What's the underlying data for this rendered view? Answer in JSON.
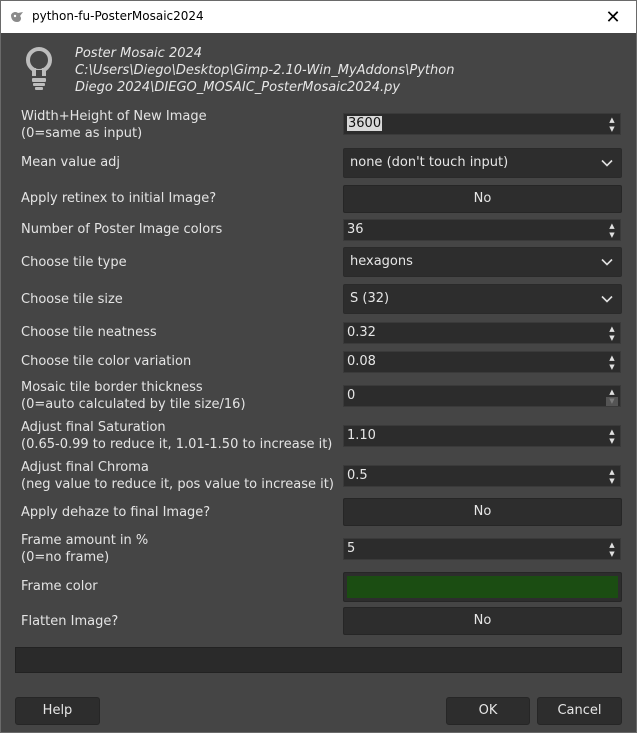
{
  "window": {
    "title": "python-fu-PosterMosaic2024",
    "close_glyph": "✕"
  },
  "header": {
    "icon": "lightbulb-icon",
    "lines": [
      "Poster Mosaic 2024",
      "C:\\Users\\Diego\\Desktop\\Gimp-2.10-Win_MyAddons\\Python",
      "Diego 2024\\DIEGO_MOSAIC_PosterMosaic2024.py"
    ]
  },
  "fields": {
    "width_height": {
      "label_1": "Width+Height of New Image",
      "label_2": " (0=same as input)",
      "value": "3600"
    },
    "mean_value": {
      "label": "Mean value adj",
      "value": "none (don't touch input)"
    },
    "retinex": {
      "label": "Apply retinex to initial Image?",
      "value": "No"
    },
    "poster_colors": {
      "label": "Number of Poster Image colors",
      "value": "36"
    },
    "tile_type": {
      "label": "Choose tile type",
      "value": "hexagons"
    },
    "tile_size": {
      "label": "Choose tile size",
      "value": "S  (32)"
    },
    "tile_neatness": {
      "label": "Choose tile neatness",
      "value": "0.32"
    },
    "tile_color_variation": {
      "label": "Choose tile color variation",
      "value": "0.08"
    },
    "border_thickness": {
      "label_1": "Mosaic tile border thickness",
      "label_2": " (0=auto calculated by tile size/16)",
      "value": "0"
    },
    "saturation": {
      "label_1": "Adjust final Saturation",
      "label_2": " (0.65-0.99 to reduce it, 1.01-1.50 to increase it)",
      "value": "1.10"
    },
    "chroma": {
      "label_1": "Adjust final Chroma",
      "label_2": " (neg value to reduce it, pos value to increase it)",
      "value": "0.5"
    },
    "dehaze": {
      "label": "Apply dehaze to final Image?",
      "value": "No"
    },
    "frame_amount": {
      "label_1": "Frame amount in %",
      "label_2": " (0=no frame)",
      "value": "5"
    },
    "frame_color": {
      "label": "Frame color",
      "color": "#1b4d12"
    },
    "flatten": {
      "label": "Flatten Image?",
      "value": "No"
    }
  },
  "buttons": {
    "help": "Help",
    "ok": "OK",
    "cancel": "Cancel"
  },
  "colors": {
    "background": "#454545",
    "input": "#2c2c2c",
    "frame_color": "#1b4d12"
  }
}
